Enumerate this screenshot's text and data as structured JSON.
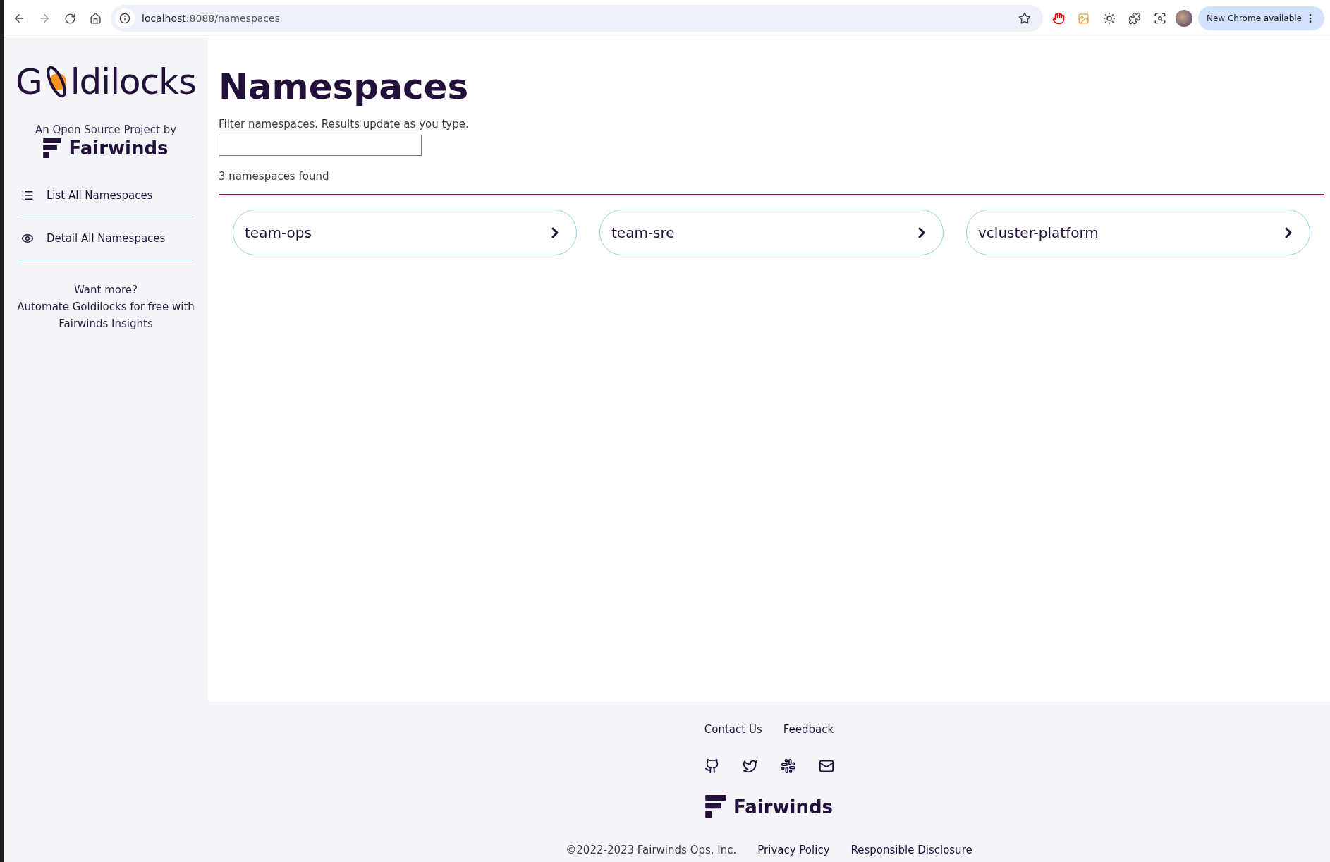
{
  "browser": {
    "url_host": "localhost",
    "url_rest": ":8088/namespaces",
    "forward_disabled": true,
    "update_button": "New Chrome available"
  },
  "sidebar": {
    "logo": {
      "before": "G",
      "after": "ldilocks"
    },
    "byline": "An Open Source Project by",
    "brand": "Fairwinds",
    "nav": [
      {
        "label": "List All Namespaces"
      },
      {
        "label": "Detail All Namespaces"
      }
    ],
    "promo": [
      "Want more?",
      "Automate Goldilocks for free with",
      "Fairwinds Insights"
    ]
  },
  "main": {
    "title": "Namespaces",
    "filter_label": "Filter namespaces. Results update as you type.",
    "count": "3 namespaces found",
    "namespaces": [
      "team-ops",
      "team-sre",
      "vcluster-platform"
    ]
  },
  "footer": {
    "links": [
      "Contact Us",
      "Feedback"
    ],
    "brand": "Fairwinds",
    "copyright": "©2022-2023 Fairwinds Ops, Inc.",
    "legal": [
      "Privacy Policy",
      "Responsible Disclosure"
    ]
  }
}
